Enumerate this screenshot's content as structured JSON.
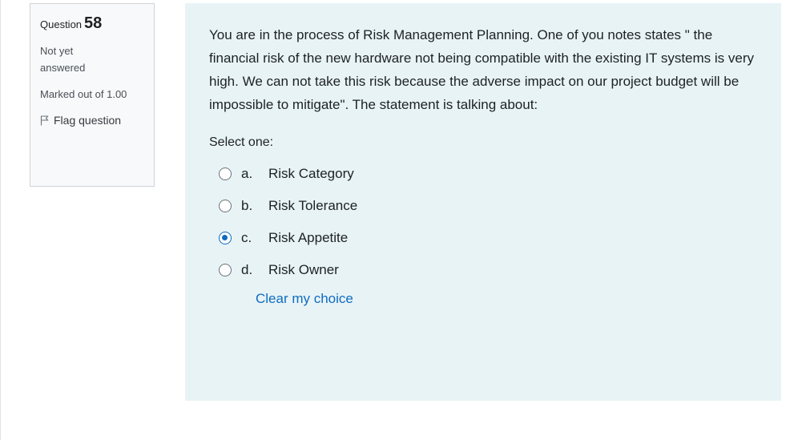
{
  "info": {
    "question_label": "Question",
    "question_number": "58",
    "state": "Not yet answered",
    "grade": "Marked out of 1.00",
    "flag_label": "Flag question"
  },
  "question": {
    "text": "You are in the process of Risk Management Planning. One of you notes states \" the financial risk of the new hardware not being compatible with the existing IT systems is very high. We can not take this risk because the adverse impact on our project budget will be impossible to mitigate\". The statement is talking about:",
    "prompt": "Select one:",
    "answers": [
      {
        "letter": "a.",
        "label": "Risk Category",
        "selected": false
      },
      {
        "letter": "b.",
        "label": "Risk Tolerance",
        "selected": false
      },
      {
        "letter": "c.",
        "label": "Risk Appetite",
        "selected": true
      },
      {
        "letter": "d.",
        "label": "Risk Owner",
        "selected": false
      }
    ],
    "clear_label": "Clear my choice"
  },
  "colors": {
    "content_bg": "#e8f3f6",
    "accent": "#0f6cbf"
  }
}
